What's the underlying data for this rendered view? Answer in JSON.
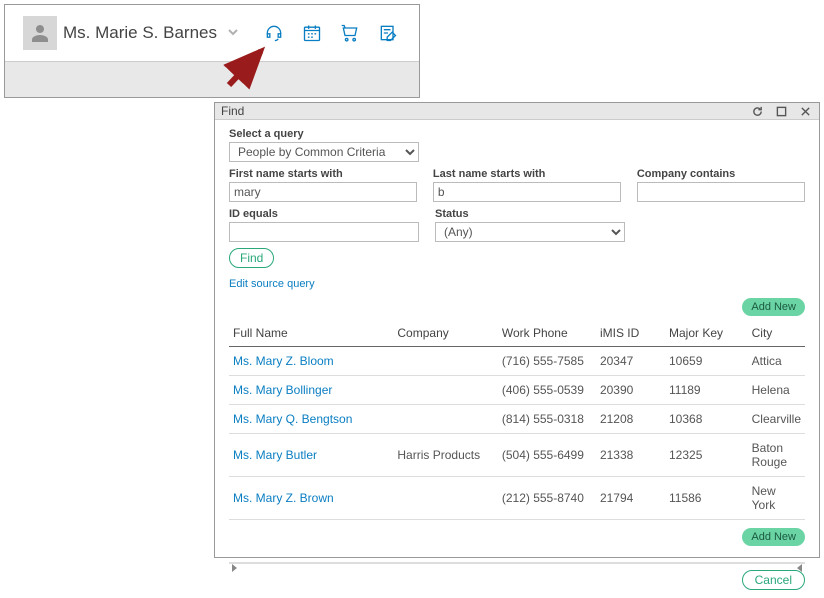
{
  "header": {
    "contact_name": "Ms. Marie S. Barnes"
  },
  "find": {
    "title": "Find",
    "select_query_label": "Select a query",
    "select_query_value": "People by Common Criteria",
    "first_name_label": "First name starts with",
    "first_name_value": "mary",
    "last_name_label": "Last name starts with",
    "last_name_value": "b",
    "company_label": "Company contains",
    "company_value": "",
    "id_equals_label": "ID equals",
    "id_equals_value": "",
    "status_label": "Status",
    "status_value": "(Any)",
    "find_button": "Find",
    "edit_source": "Edit source query",
    "add_new": "Add New",
    "cancel": "Cancel",
    "columns": {
      "full_name": "Full Name",
      "company": "Company",
      "work_phone": "Work Phone",
      "imis_id": "iMIS ID",
      "major_key": "Major Key",
      "city": "City"
    },
    "rows": [
      {
        "name": "Ms. Mary Z. Bloom",
        "company": "",
        "phone": "(716) 555-7585",
        "id": "20347",
        "key": "10659",
        "city": "Attica"
      },
      {
        "name": "Ms. Mary Bollinger",
        "company": "",
        "phone": "(406) 555-0539",
        "id": "20390",
        "key": "11189",
        "city": "Helena"
      },
      {
        "name": "Ms. Mary Q. Bengtson",
        "company": "",
        "phone": "(814) 555-0318",
        "id": "21208",
        "key": "10368",
        "city": "Clearville"
      },
      {
        "name": "Ms. Mary Butler",
        "company": "Harris Products",
        "phone": "(504) 555-6499",
        "id": "21338",
        "key": "12325",
        "city": "Baton Rouge"
      },
      {
        "name": "Ms. Mary Z. Brown",
        "company": "",
        "phone": "(212) 555-8740",
        "id": "21794",
        "key": "11586",
        "city": "New York"
      }
    ]
  }
}
